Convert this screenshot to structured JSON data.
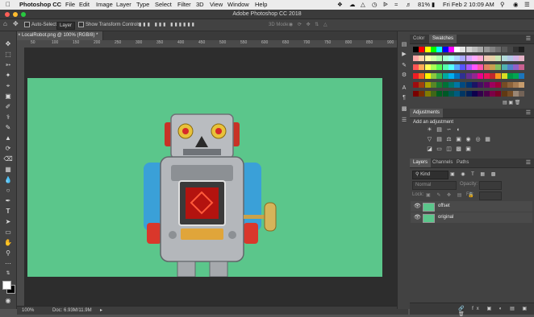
{
  "menubar": {
    "app_name": "Photoshop CC",
    "items": [
      "File",
      "Edit",
      "Image",
      "Layer",
      "Type",
      "Select",
      "Filter",
      "3D",
      "View",
      "Window",
      "Help"
    ],
    "battery": "81%",
    "clock": "Fri Feb 2  10:09 AM"
  },
  "window": {
    "title": "Adobe Photoshop CC 2018"
  },
  "options_bar": {
    "auto_select_label": "Auto-Select:",
    "auto_select_value": "Layer",
    "transform_label": "Show Transform Controls",
    "mode_3d": "3D Mode:"
  },
  "document": {
    "tab_title": "LocalRobot.png @ 100% (RGB/8) *",
    "ruler_ticks": [
      "50",
      "100",
      "150",
      "200",
      "250",
      "300",
      "350",
      "400",
      "450",
      "500",
      "550",
      "600",
      "650",
      "700",
      "750",
      "800",
      "850",
      "900"
    ],
    "zoom": "100%",
    "doc_size": "Doc: 6.93M/11.9M",
    "canvas_color": "#5bc68b"
  },
  "color_panel": {
    "tabs": [
      "Color",
      "Swatches"
    ],
    "active_tab": "Swatches",
    "swatch_rows": [
      [
        "#000000",
        "#ff0000",
        "#ffff00",
        "#00ff00",
        "#00ffff",
        "#0000ff",
        "#ff00ff",
        "#ffffff",
        "#e6e6e6",
        "#d2d2d2",
        "#bebebe",
        "#aaaaaa",
        "#969696",
        "#828282",
        "#6e6e6e",
        "#5a5a5a",
        "#464646",
        "#323232",
        "#1e1e1e"
      ],
      [
        "#ffaaaa",
        "#ffd4aa",
        "#ffffaa",
        "#d4ffaa",
        "#aaffaa",
        "#aaffd4",
        "#aaffff",
        "#aad4ff",
        "#aaaaff",
        "#d4aaff",
        "#ffaaff",
        "#ffaad4",
        "#f0c8b4",
        "#e6d2aa",
        "#c8e6b4",
        "#b4dcdc",
        "#b4c8e6",
        "#d2b4e6",
        "#e6b4c8"
      ],
      [
        "#ff5555",
        "#ffaa55",
        "#ffff55",
        "#aaff55",
        "#55ff55",
        "#55ffaa",
        "#55ffff",
        "#55aaff",
        "#5555ff",
        "#aa55ff",
        "#ff55ff",
        "#ff55aa",
        "#e08060",
        "#c8a050",
        "#80c060",
        "#50b0b0",
        "#5080c8",
        "#9060c8",
        "#c86090"
      ],
      [
        "#ee1c24",
        "#f26522",
        "#fff200",
        "#8dc63f",
        "#39b54a",
        "#00a99d",
        "#00aeef",
        "#0072bc",
        "#2e3192",
        "#662d91",
        "#92278f",
        "#ec008c",
        "#ed145b",
        "#c1272d",
        "#f7941d",
        "#d7df23",
        "#009444",
        "#00a651",
        "#1b75bc"
      ],
      [
        "#9e0b0f",
        "#a0410d",
        "#aba000",
        "#598527",
        "#197b30",
        "#007236",
        "#00746b",
        "#0076a3",
        "#004a80",
        "#003471",
        "#1b1464",
        "#440e62",
        "#630460",
        "#9e005d",
        "#9e0039",
        "#754c24",
        "#8c6239",
        "#a67c52",
        "#c69c6d"
      ],
      [
        "#790000",
        "#7b2e00",
        "#827b00",
        "#406618",
        "#005e20",
        "#005826",
        "#005952",
        "#005b7f",
        "#003663",
        "#002157",
        "#0d004c",
        "#32004b",
        "#4b0049",
        "#7b0046",
        "#7a0026",
        "#603913",
        "#754c24",
        "#998675",
        "#736357"
      ]
    ]
  },
  "adjustments_panel": {
    "title": "Adjustments",
    "subtitle": "Add an adjustment",
    "icon_rows": [
      [
        "brightness-contrast-icon",
        "levels-icon",
        "curves-icon",
        "exposure-icon"
      ],
      [
        "vibrance-icon",
        "hue-saturation-icon",
        "color-balance-icon",
        "black-white-icon",
        "photo-filter-icon",
        "channel-mixer-icon",
        "color-lookup-icon"
      ],
      [
        "invert-icon",
        "posterize-icon",
        "threshold-icon",
        "gradient-map-icon",
        "selective-color-icon"
      ]
    ]
  },
  "layers_panel": {
    "tabs": [
      "Layers",
      "Channels",
      "Paths"
    ],
    "active_tab": "Layers",
    "filter_kind": "Kind",
    "blend_mode": "Normal",
    "opacity_label": "Opacity:",
    "lock_label": "Lock:",
    "fill_label": "Fill:",
    "layers": [
      {
        "name": "offset"
      },
      {
        "name": "original"
      }
    ]
  }
}
